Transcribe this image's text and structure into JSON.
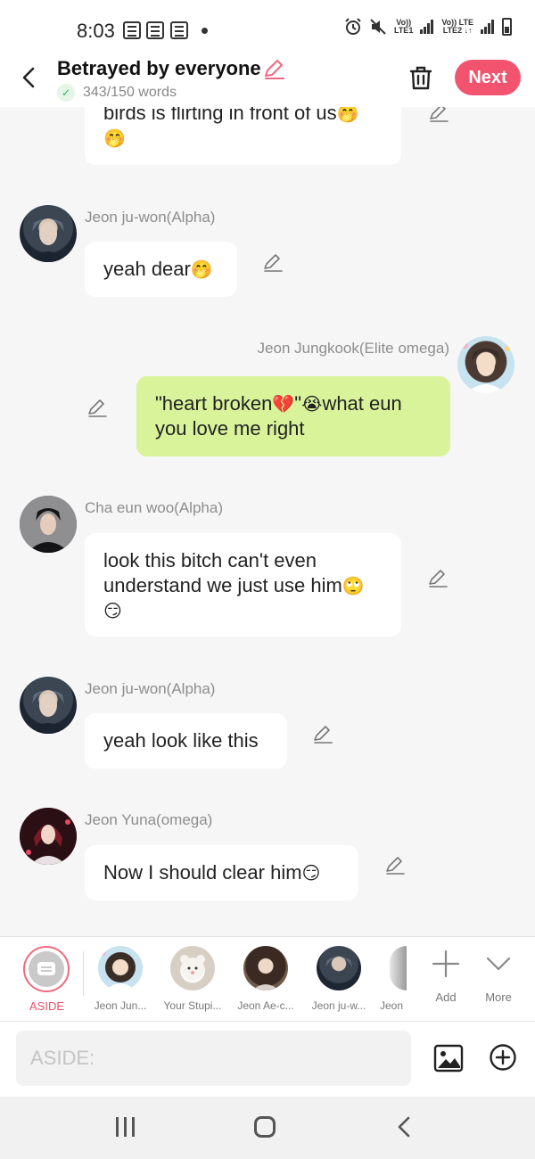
{
  "status_bar": {
    "time": "8:03",
    "sim1_label_top": "Vo))",
    "sim1_label_bottom": "LTE1",
    "sim2_label_top": "Vo)) LTE",
    "sim2_label_bottom": "LTE2 ↓↑",
    "icons": [
      "notes-icon",
      "notes-icon",
      "notes-icon",
      "alarm-icon",
      "mute-icon",
      "signal-icon",
      "signal-icon",
      "battery-icon"
    ]
  },
  "header": {
    "title": "Betrayed by everyone",
    "word_count": "343/150 words",
    "next_label": "Next",
    "accent_color": "#f2546f"
  },
  "messages": [
    {
      "side": "left",
      "text": "birds is flirting in front of us",
      "emoji": "🤭",
      "emoji2": "🤭"
    },
    {
      "side": "left",
      "sender": "Jeon ju-won(Alpha)",
      "avatar": "jeon-ju-won-avatar",
      "text": "yeah dear",
      "emoji": "🤭"
    },
    {
      "side": "right",
      "sender": "Jeon Jungkook(Elite omega)",
      "avatar": "jeon-jungkook-avatar",
      "text_a": "\"heart broken",
      "emoji_a": "💔",
      "text_b": "\"",
      "emoji_b": "😭",
      "text_c": "what eun",
      "text_d": "you  love me right"
    },
    {
      "side": "left",
      "sender": "Cha eun woo(Alpha)",
      "avatar": "cha-eun-woo-avatar",
      "text_a": "look this bitch can't even",
      "text_b": "understand we just use him",
      "emoji_a": "🙄",
      "emoji_b": "😏"
    },
    {
      "side": "left",
      "sender": "Jeon ju-won(Alpha)",
      "avatar": "jeon-ju-won-avatar",
      "text": "yeah look like this"
    },
    {
      "side": "left",
      "sender": "Jeon Yuna(omega)",
      "avatar": "jeon-yuna-avatar",
      "text": "Now I should clear him",
      "emoji": "😏"
    }
  ],
  "character_bar": {
    "aside_label": "ASIDE",
    "characters": [
      {
        "name": "Jeon Jun...",
        "avatar": "jeon-jungkook-avatar"
      },
      {
        "name": "Your Stupi...",
        "avatar": "your-stupid-avatar"
      },
      {
        "name": "Jeon Ae-c...",
        "avatar": "jeon-ae-c-avatar"
      },
      {
        "name": "Jeon ju-w...",
        "avatar": "jeon-ju-won-avatar"
      },
      {
        "name": "Jeon",
        "avatar": "jeon-partial-avatar"
      }
    ],
    "add_label": "Add",
    "more_label": "More"
  },
  "input": {
    "placeholder": "ASIDE:"
  }
}
